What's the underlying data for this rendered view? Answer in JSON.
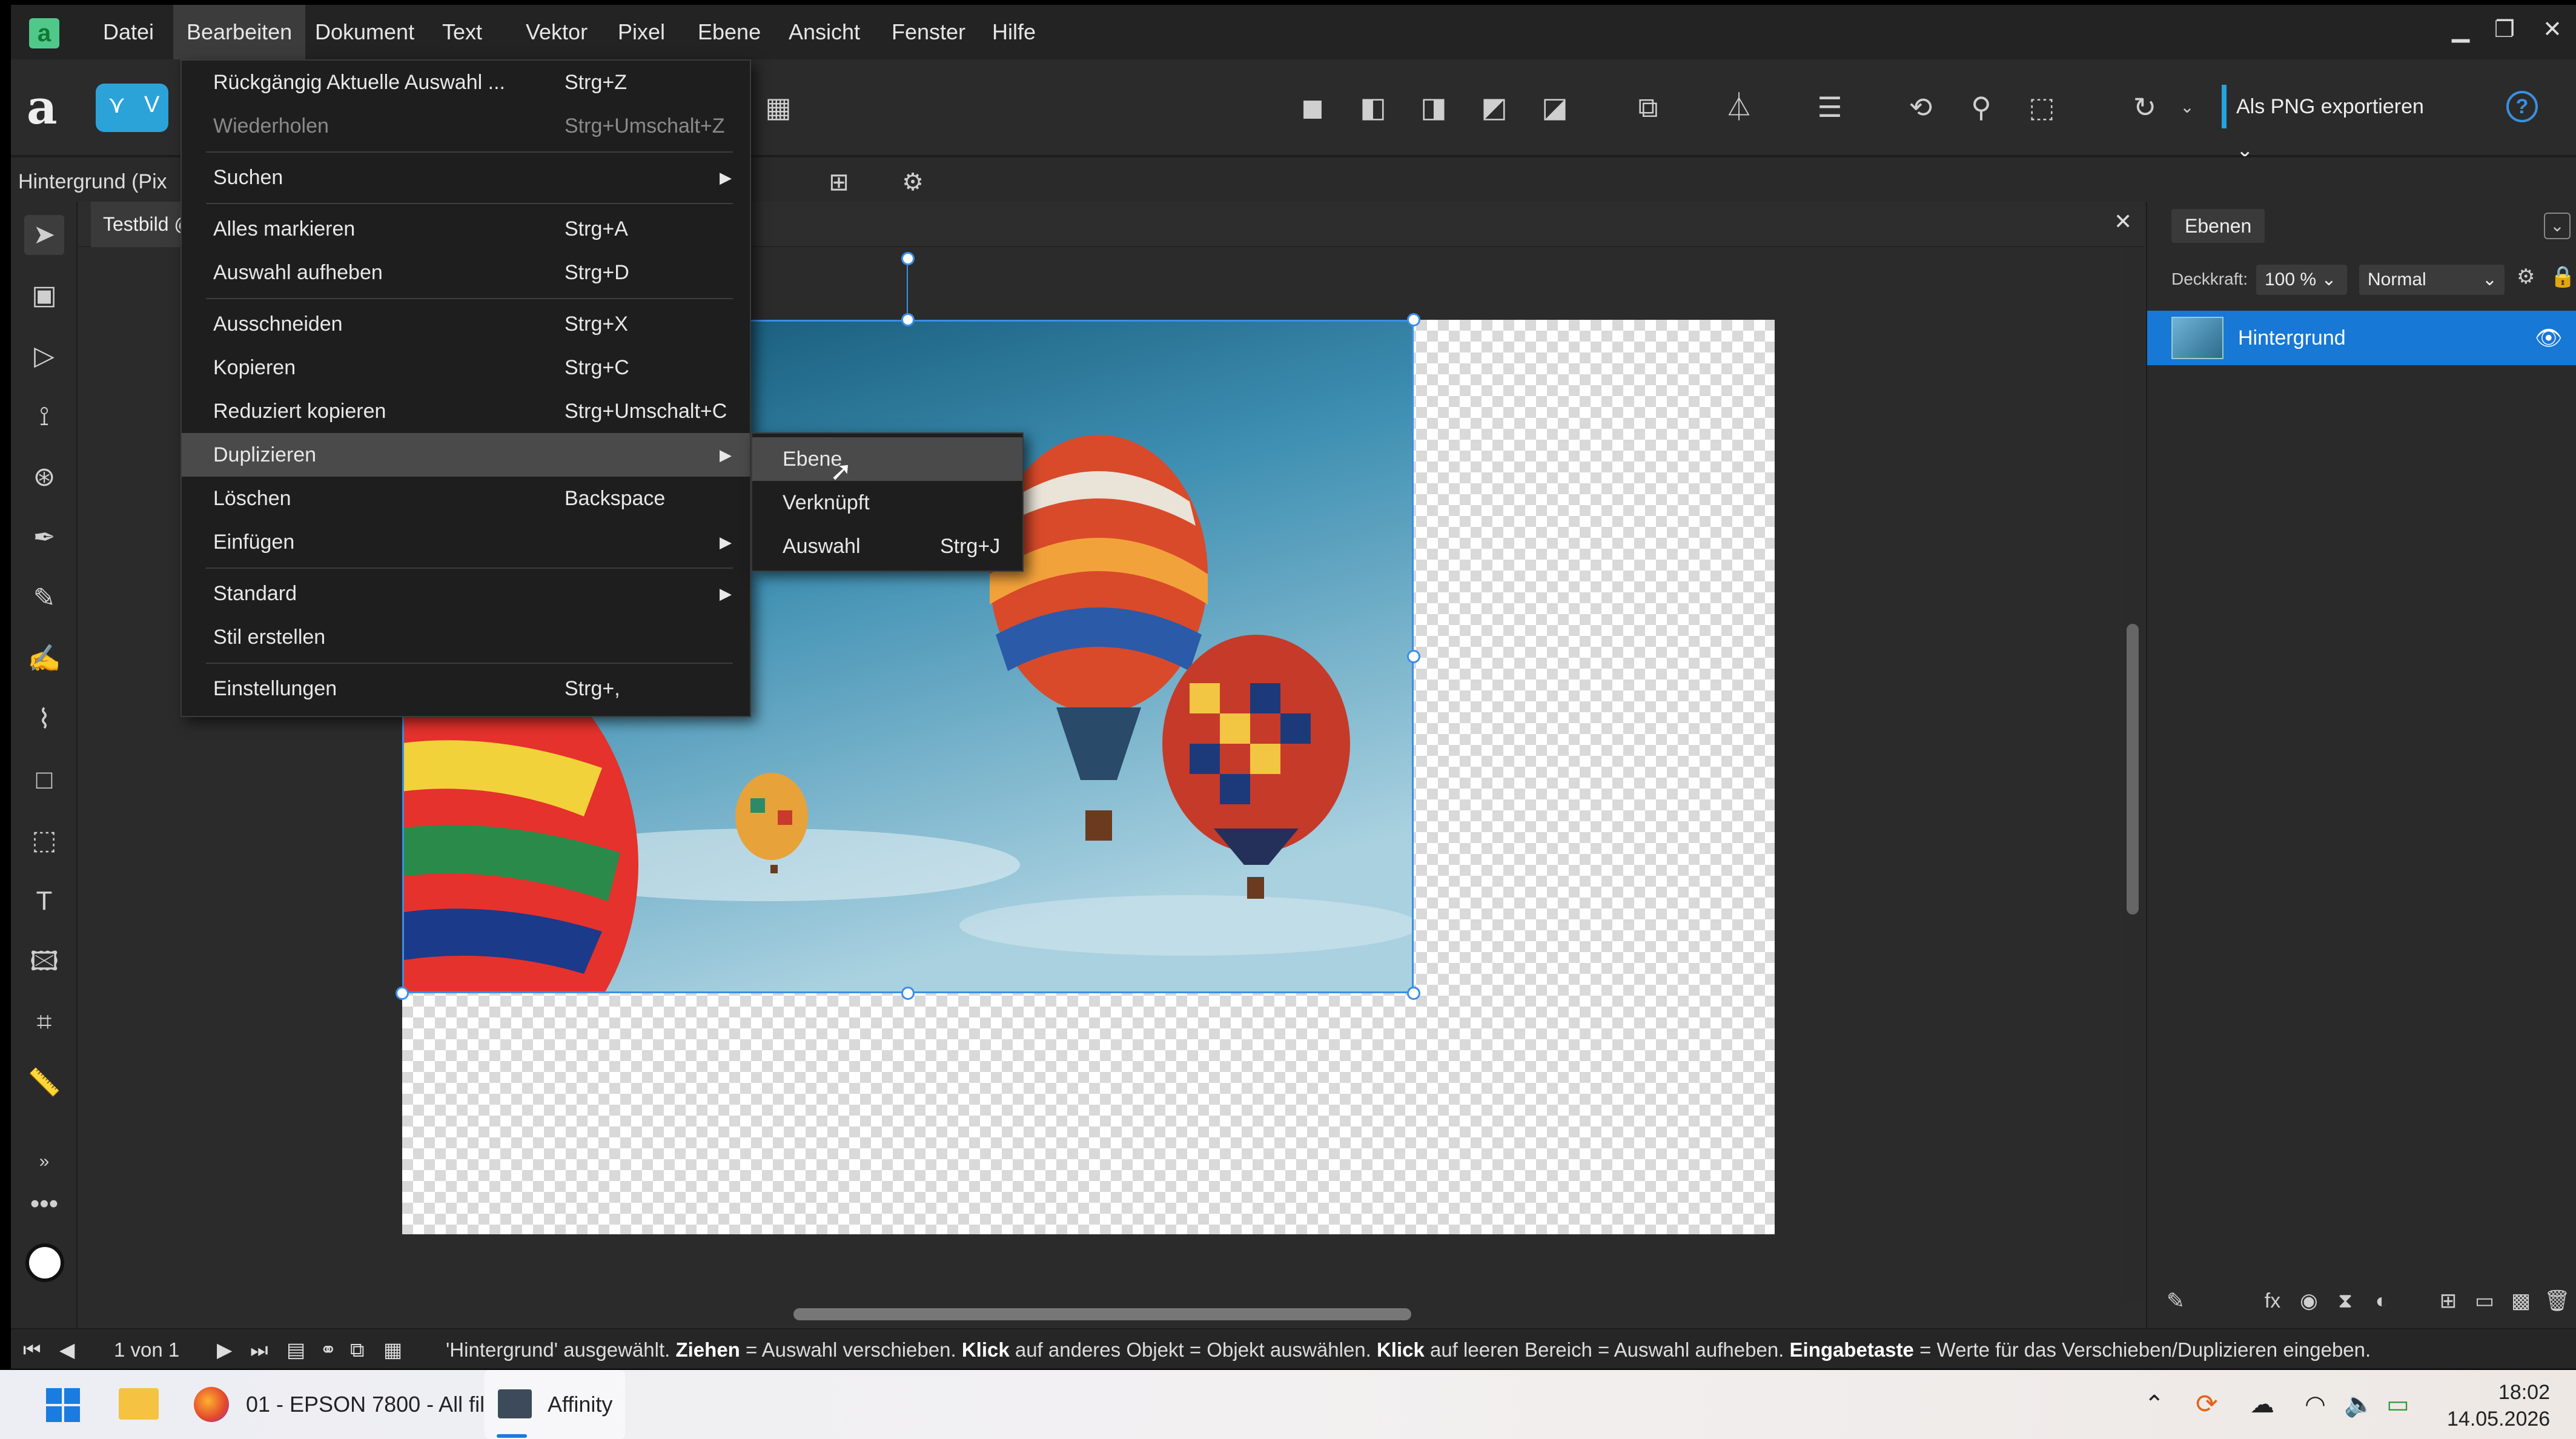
{
  "menubar": {
    "items": [
      "Datei",
      "Bearbeiten",
      "Dokument",
      "Text",
      "Vektor",
      "Pixel",
      "Ebene",
      "Ansicht",
      "Fenster",
      "Hilfe"
    ]
  },
  "toolbar": {
    "persona_label": "V",
    "export_label": "Als PNG exportieren",
    "help_label": "?"
  },
  "context": {
    "layer_label": "Hintergrund (Pix",
    "partial_text": "te"
  },
  "document": {
    "tab_label": "Testbild @"
  },
  "edit_menu": {
    "items": [
      {
        "label": "Rückgängig Aktuelle Auswahl ...",
        "shortcut": "Strg+Z"
      },
      {
        "label": "Wiederholen",
        "shortcut": "Strg+Umschalt+Z"
      },
      {
        "label": "Suchen",
        "shortcut": ""
      },
      {
        "label": "Alles markieren",
        "shortcut": "Strg+A"
      },
      {
        "label": "Auswahl aufheben",
        "shortcut": "Strg+D"
      },
      {
        "label": "Ausschneiden",
        "shortcut": "Strg+X"
      },
      {
        "label": "Kopieren",
        "shortcut": "Strg+C"
      },
      {
        "label": "Reduziert kopieren",
        "shortcut": "Strg+Umschalt+C"
      },
      {
        "label": "Duplizieren",
        "shortcut": ""
      },
      {
        "label": "Löschen",
        "shortcut": "Backspace"
      },
      {
        "label": "Einfügen",
        "shortcut": ""
      },
      {
        "label": "Standard",
        "shortcut": ""
      },
      {
        "label": "Stil erstellen",
        "shortcut": ""
      },
      {
        "label": "Einstellungen",
        "shortcut": "Strg+,"
      }
    ]
  },
  "duplicate_submenu": {
    "items": [
      {
        "label": "Ebene",
        "shortcut": ""
      },
      {
        "label": "Verknüpft",
        "shortcut": ""
      },
      {
        "label": "Auswahl",
        "shortcut": "Strg+J"
      }
    ]
  },
  "layers_panel": {
    "tab": "Ebenen",
    "opacity_label": "Deckkraft:",
    "opacity_value": "100 %",
    "blend_mode": "Normal",
    "layer_name": "Hintergrund"
  },
  "statusbar": {
    "page": "1 von 1",
    "msg": [
      {
        "t": "'Hintergrund' ausgewählt. ",
        "b": false
      },
      {
        "t": "Ziehen",
        "b": true
      },
      {
        "t": " = Auswahl verschieben. ",
        "b": false
      },
      {
        "t": "Klick",
        "b": true
      },
      {
        "t": " auf anderes Objekt = Objekt auswählen. ",
        "b": false
      },
      {
        "t": "Klick",
        "b": true
      },
      {
        "t": " auf leeren Bereich = Auswahl aufheben. ",
        "b": false
      },
      {
        "t": "Eingabetaste",
        "b": true
      },
      {
        "t": " = Werte für das Verschieben/Duplizieren eingeben.",
        "b": false
      }
    ]
  },
  "taskbar": {
    "firefox_title": "01 - EPSON 7800 - All fil",
    "affinity_title": "Affinity",
    "time": "18:02",
    "date": "14.05.2026"
  },
  "colors": {
    "accent": "#1778d6",
    "selection": "#3a8ee8",
    "menu_bg": "#1e1e1e",
    "menu_highlight": "#4a4a4a"
  }
}
